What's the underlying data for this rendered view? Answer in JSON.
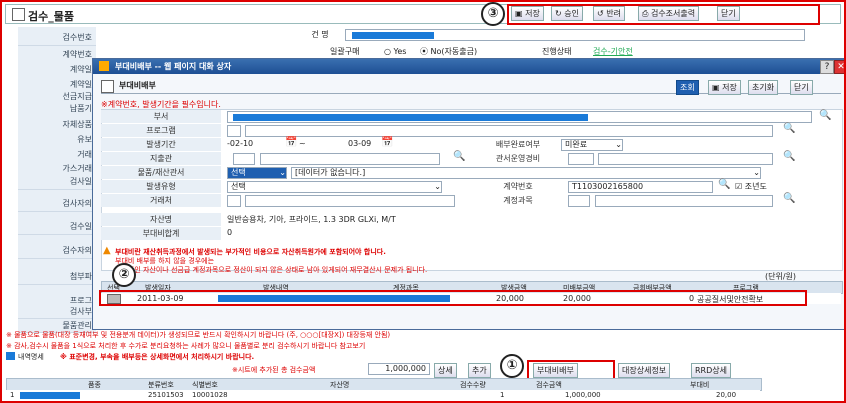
{
  "back": {
    "title": "검수_물품",
    "toolbar": [
      {
        "name": "save",
        "label": "저장"
      },
      {
        "name": "approve",
        "label": "승인"
      },
      {
        "name": "return",
        "label": "반려"
      },
      {
        "name": "inspection-print",
        "label": "검수조서출력"
      },
      {
        "name": "close",
        "label": "닫기"
      }
    ],
    "labels": [
      "검수번호",
      "계약번호",
      "계약일",
      "계약일",
      "선금지급",
      "납품기",
      "자체상품",
      "유보",
      "거래",
      "가스거래",
      "검사일",
      "검사자의",
      "검수일",
      "검수자의",
      "첨부파",
      "프로그",
      "검사부",
      "물품관리"
    ],
    "fields": {
      "subject_label": "건 명",
      "bulk_label": "일괄구매",
      "yes": "Yes",
      "no": "No(자동출금)",
      "progress_label": "진행상태",
      "progress_value": "검수-기안전"
    },
    "notices": [
      "※ 물품으로 물품(대장 등재여부 및 전용분개 데이터)가 생성되므로 반드시 확인하시기 바랍니다 (주, ○○○[대장X]) 대장등재 안됨)",
      "※ 감사,검수시 물품을 1식으로 처리한 후 수가로 분리요청하는 사례가 많으니 물품별로 분리 검수하시기 바랍니다 참고보기"
    ],
    "section_title": "내역명세",
    "section_notice": "※ 표준변경, 부속을 배부등은 상세화면에서 처리하시기 바랍니다.",
    "sheet_note": "※시트에 추가된 총 검수금액",
    "total_amount": "1,000,000",
    "sheet_buttons": [
      "상세",
      "추가",
      "부대비배부",
      "대장상세정보",
      "RRD상세"
    ],
    "grid_headers": [
      "품종",
      "분류번호",
      "식별번호",
      "자산명",
      "검수수량",
      "검수금액",
      "부대비"
    ],
    "grid_row": {
      "no": "1",
      "class_no": "25101503",
      "id_no": "10001028",
      "qty": "1",
      "amount": "1,000,000",
      "extra": "20,00"
    }
  },
  "popup": {
    "window_title": "부대비배부 -- 웹 페이지 대화 상자",
    "sub_title": "부대비배부",
    "buttons": [
      "조회",
      "저장",
      "초기화",
      "닫기"
    ],
    "warning": "※계약번호, 발생기간을 필수입니다.",
    "rows": {
      "dept": "부서",
      "program": "프로그램",
      "period": "발생기간",
      "period_from": "-02-10",
      "period_to": "03-09",
      "dist_status_label": "배부완료여부",
      "dist_status_value": "미완료",
      "payer": "지출관",
      "ops_cost": "관서운영경비",
      "item_label": "물품/재산관서",
      "item_select": "선택",
      "item_hint": "[데이터가 없습니다.]",
      "type_label": "발생유형",
      "type_select": "선택",
      "contract_label": "계약번호",
      "contract_value": "T1103002165800",
      "prev_year": "조년도",
      "vendor": "거래처",
      "account_label": "계정과목",
      "asset_label": "자산명",
      "asset_value": "일반승용차, 기아, 프라이드, 1.3 3DR GLXi, M/T",
      "sub_total_label": "부대비합계",
      "sub_total_value": "0"
    },
    "notice1": "부대비란 재산취득과정에서 발생되는 부가적인 비용으로 자산취득원가에 포함되어야 합니다.",
    "notice2": "부대비 배부를 하지 않을 경우에는",
    "notice3": "건설중인 자산이나 선금급 계정과목으로 정산이 되지 않은 상태로 남아 있게되어 재무결산시 문제가 됩니다.",
    "unit": "(단위/원)",
    "grid_headers": [
      "선택",
      "발생일자",
      "발생내역",
      "계정과목",
      "발생금액",
      "미배부금액",
      "금회배부금액",
      "프로그램"
    ],
    "grid_row": {
      "date": "2011-03-09",
      "amount": "20,000",
      "unpaid": "20,000",
      "this": "0",
      "program": "공공질서및안전확보"
    }
  },
  "markers": [
    "①",
    "②",
    "③"
  ]
}
